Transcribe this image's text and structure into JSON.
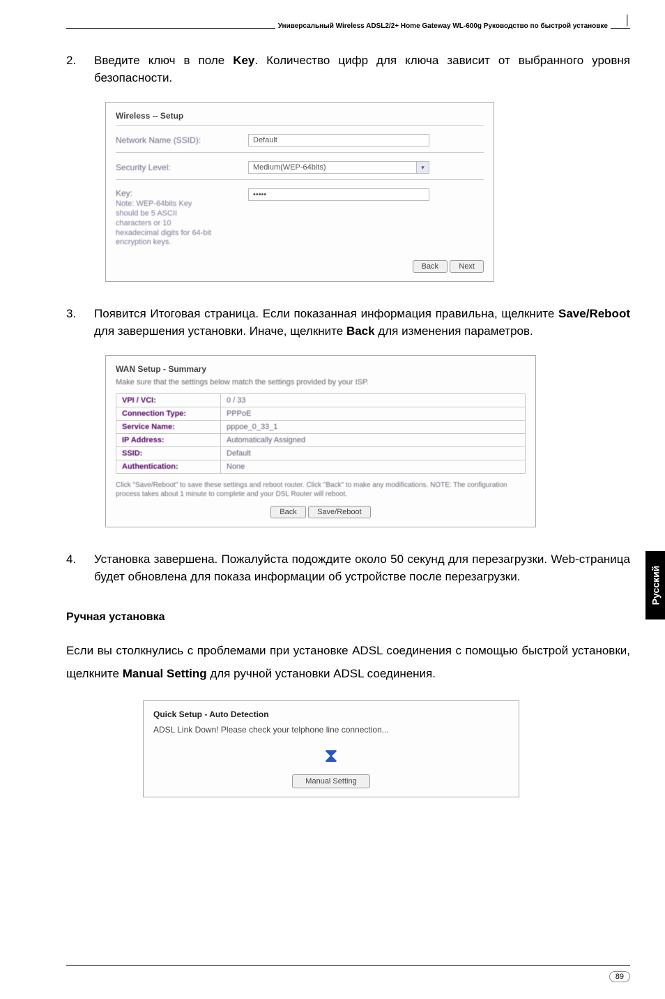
{
  "header": {
    "title": "Универсальный Wireless ADSL2/2+ Home Gateway  WL-600g Руководство по быстрой установке"
  },
  "step2": {
    "num": "2.",
    "text_a": "Введите ключ  в поле ",
    "key": "Key",
    "text_b": ". Количество цифр для ключа зависит от выбранного уровня безопасности."
  },
  "panel1": {
    "title": "Wireless -- Setup",
    "ssid_label": "Network Name (SSID):",
    "ssid_value": "Default",
    "sec_label": "Security Level:",
    "sec_value": "Medium(WEP-64bits)",
    "key_label": "Key:",
    "key_value": "•••••",
    "hint": "Note: WEP-64bits Key should be 5 ASCII characters or 10 hexadecimal digits for 64-bit encryption keys.",
    "back": "Back",
    "next": "Next"
  },
  "step3": {
    "num": "3.",
    "text_a": "Появится Итоговая страница. Если показанная информация правильна, щелкните ",
    "save": "Save/Reboot",
    "text_b": " для завершения установки. Иначе, щелкните ",
    "back": "Back",
    "text_c": " для изменения параметров."
  },
  "panel2": {
    "title": "WAN Setup - Summary",
    "intro": "Make sure that the settings below match the settings provided by your ISP.",
    "rows": [
      {
        "k": "VPI / VCI:",
        "v": "0 / 33"
      },
      {
        "k": "Connection Type:",
        "v": "PPPoE"
      },
      {
        "k": "Service Name:",
        "v": "pppoe_0_33_1"
      },
      {
        "k": "IP Address:",
        "v": "Automatically Assigned"
      },
      {
        "k": "SSID:",
        "v": "Default"
      },
      {
        "k": "Authentication:",
        "v": "None"
      }
    ],
    "note": "Click \"Save/Reboot\" to save these settings and reboot router. Click \"Back\" to make any modifications. NOTE: The configuration process takes about 1 minute to complete and your DSL Router will reboot.",
    "back": "Back",
    "save": "Save/Reboot"
  },
  "step4": {
    "num": "4.",
    "text": "Установка завершена. Пожалуйста подождите около 50 секунд для перезагрузки. Web-страница будет обновлена для показа информации об устройстве после перезагрузки."
  },
  "manual": {
    "heading": "Ручная установка",
    "para_a": "Если вы столкнулись с проблемами при установке ADSL соединения с помощью быстрой установки, щелкните ",
    "bold": "Manual Setting",
    "para_b": " для ручной установки ADSL соединения."
  },
  "panel3": {
    "title": "Quick Setup - Auto Detection",
    "msg": "ADSL Link Down! Please check your telphone line connection...",
    "btn": "Manual Setting"
  },
  "side_tab": "Русский",
  "page_number": "89"
}
